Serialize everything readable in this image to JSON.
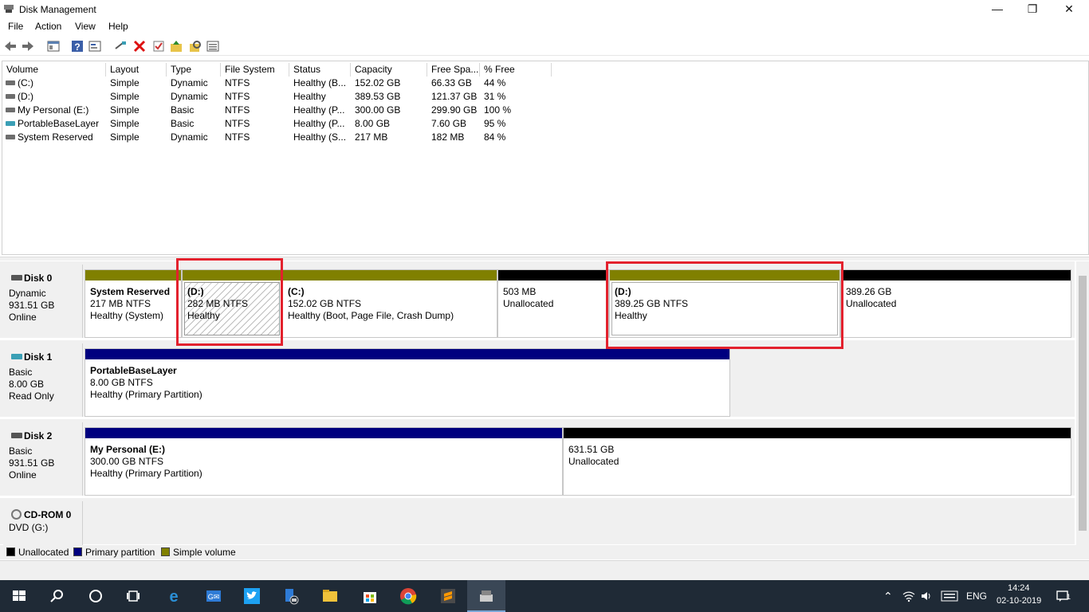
{
  "window": {
    "title": "Disk Management",
    "minimize_glyph": "—",
    "restore_glyph": "❐",
    "close_glyph": "✕"
  },
  "menu": [
    "File",
    "Action",
    "View",
    "Help"
  ],
  "toolbar_icons": [
    "back-icon",
    "forward-icon",
    "console-tree-icon",
    "help-icon",
    "properties-icon",
    "connect-icon",
    "delete-icon",
    "check-icon",
    "up-icon",
    "search-icon",
    "list-icon"
  ],
  "volume_table": {
    "columns": [
      "Volume",
      "Layout",
      "Type",
      "File System",
      "Status",
      "Capacity",
      "Free Spa...",
      "% Free"
    ],
    "rows": [
      {
        "volume": " (C:)",
        "layout": "Simple",
        "type": "Dynamic",
        "fs": "NTFS",
        "status": "Healthy (B...",
        "capacity": "152.02 GB",
        "free": "66.33 GB",
        "pct": "44 %",
        "icon": "drive-icon"
      },
      {
        "volume": " (D:)",
        "layout": "Simple",
        "type": "Dynamic",
        "fs": "NTFS",
        "status": "Healthy",
        "capacity": "389.53 GB",
        "free": "121.37 GB",
        "pct": "31 %",
        "icon": "drive-icon"
      },
      {
        "volume": "My Personal (E:)",
        "layout": "Simple",
        "type": "Basic",
        "fs": "NTFS",
        "status": "Healthy (P...",
        "capacity": "300.00 GB",
        "free": "299.90 GB",
        "pct": "100 %",
        "icon": "drive-icon"
      },
      {
        "volume": "PortableBaseLayer",
        "layout": "Simple",
        "type": "Basic",
        "fs": "NTFS",
        "status": "Healthy (P...",
        "capacity": "8.00 GB",
        "free": "7.60 GB",
        "pct": "95 %",
        "icon": "usb-drive-icon"
      },
      {
        "volume": "System Reserved",
        "layout": "Simple",
        "type": "Dynamic",
        "fs": "NTFS",
        "status": "Healthy (S...",
        "capacity": "217 MB",
        "free": "182 MB",
        "pct": "84 %",
        "icon": "drive-icon"
      }
    ]
  },
  "disks": [
    {
      "name": "Disk 0",
      "lines": [
        "Dynamic",
        "931.51 GB",
        "Online"
      ],
      "partitions": [
        {
          "title": "System Reserved",
          "size": "217 MB NTFS",
          "status": "Healthy (System)"
        },
        {
          "title": " (D:)",
          "size": "282 MB NTFS",
          "status": "Healthy"
        },
        {
          "title": " (C:)",
          "size": "152.02 GB NTFS",
          "status": "Healthy (Boot, Page File, Crash Dump)"
        },
        {
          "title": "",
          "size": "503 MB",
          "status": "Unallocated"
        },
        {
          "title": " (D:)",
          "size": "389.25 GB NTFS",
          "status": "Healthy"
        },
        {
          "title": "",
          "size": "389.26 GB",
          "status": "Unallocated"
        }
      ]
    },
    {
      "name": "Disk 1",
      "lines": [
        "Basic",
        "8.00 GB",
        "Read Only"
      ],
      "partitions": [
        {
          "title": "PortableBaseLayer",
          "size": "8.00 GB NTFS",
          "status": "Healthy (Primary Partition)"
        }
      ]
    },
    {
      "name": "Disk 2",
      "lines": [
        "Basic",
        "931.51 GB",
        "Online"
      ],
      "partitions": [
        {
          "title": "My Personal  (E:)",
          "size": "300.00 GB NTFS",
          "status": "Healthy (Primary Partition)"
        },
        {
          "title": "",
          "size": "631.51 GB",
          "status": "Unallocated"
        }
      ]
    },
    {
      "name": "CD-ROM 0",
      "lines": [
        "DVD (G:)"
      ],
      "partitions": []
    }
  ],
  "legend": [
    {
      "label": "Unallocated",
      "color": "#000000"
    },
    {
      "label": "Primary partition",
      "color": "#00007f"
    },
    {
      "label": "Simple volume",
      "color": "#808000"
    }
  ],
  "taskbar": {
    "language": "ENG",
    "time": "14:24",
    "date": "02-10-2019",
    "notification_count": "1",
    "icons": [
      "windows-start-icon",
      "search-icon",
      "cortana-icon",
      "task-view-icon",
      "edge-icon",
      "gmail-app-icon",
      "twitter-icon",
      "outlook-icon",
      "file-explorer-icon",
      "store-icon",
      "chrome-icon",
      "sublime-icon",
      "disk-management-icon"
    ]
  },
  "colors": {
    "simple_volume": "#808000",
    "primary_partition": "#00007f",
    "unallocated": "#000000",
    "highlight": "#e3212d",
    "taskbar": "#1f2a36"
  }
}
